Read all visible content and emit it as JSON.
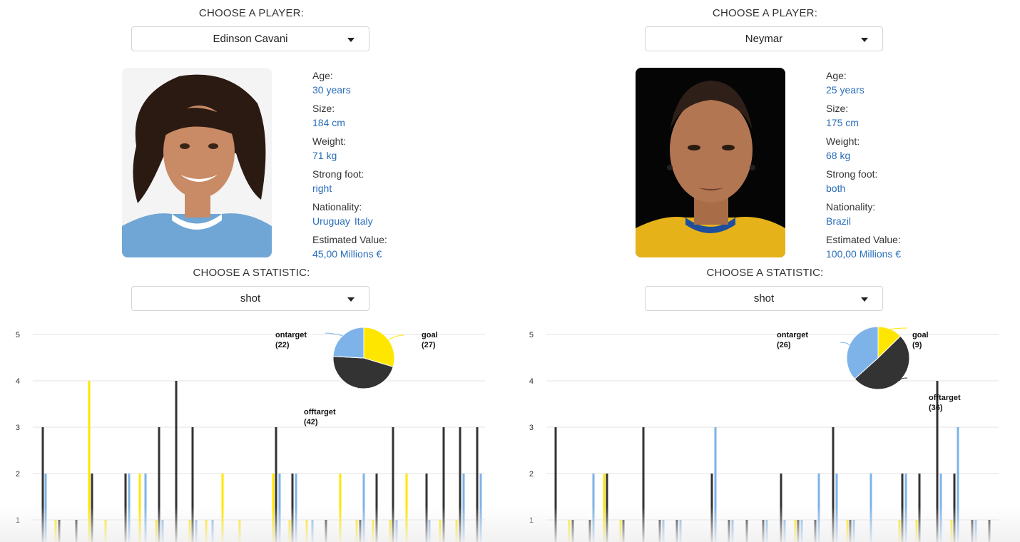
{
  "labels": {
    "choose_player": "CHOOSE A PLAYER:",
    "choose_statistic": "CHOOSE A STATISTIC:"
  },
  "colors": {
    "goal": "#ffe600",
    "ontarget": "#7db3e8",
    "offtarget": "#333333",
    "accent": "#2a6ebb"
  },
  "players": [
    {
      "name": "Edinson Cavani",
      "statistic": "shot",
      "stats": [
        {
          "key": "Age:",
          "value": "30 years"
        },
        {
          "key": "Size:",
          "value": "184 cm"
        },
        {
          "key": "Weight:",
          "value": "71 kg"
        },
        {
          "key": "Strong foot:",
          "value": "right"
        },
        {
          "key": "Nationality:",
          "value": "Uruguay",
          "value2": "Italy"
        },
        {
          "key": "Estimated Value:",
          "value": "45,00 Millions €"
        }
      ]
    },
    {
      "name": "Neymar",
      "statistic": "shot",
      "stats": [
        {
          "key": "Age:",
          "value": "25 years"
        },
        {
          "key": "Size:",
          "value": "175 cm"
        },
        {
          "key": "Weight:",
          "value": "68 kg"
        },
        {
          "key": "Strong foot:",
          "value": "both"
        },
        {
          "key": "Nationality:",
          "value": "Brazil"
        },
        {
          "key": "Estimated Value:",
          "value": "100,00 Millions €"
        }
      ]
    }
  ],
  "chart_data": [
    {
      "type": "bar",
      "ylim": [
        0,
        5
      ],
      "yticks": [
        1,
        2,
        3,
        4,
        5
      ],
      "grid": true,
      "series_order": [
        "offtarget",
        "ontarget",
        "goal"
      ],
      "bars": [
        {
          "x": 60,
          "s": "offtarget",
          "v": 3
        },
        {
          "x": 64,
          "s": "ontarget",
          "v": 2
        },
        {
          "x": 78,
          "s": "goal",
          "v": 1
        },
        {
          "x": 83,
          "s": "offtarget",
          "v": 1
        },
        {
          "x": 107,
          "s": "offtarget",
          "v": 1
        },
        {
          "x": 125,
          "s": "goal",
          "v": 4
        },
        {
          "x": 129,
          "s": "offtarget",
          "v": 2
        },
        {
          "x": 148,
          "s": "goal",
          "v": 1
        },
        {
          "x": 176,
          "s": "offtarget",
          "v": 2
        },
        {
          "x": 181,
          "s": "ontarget",
          "v": 2
        },
        {
          "x": 196,
          "s": "goal",
          "v": 2
        },
        {
          "x": 204,
          "s": "ontarget",
          "v": 2
        },
        {
          "x": 219,
          "s": "goal",
          "v": 1
        },
        {
          "x": 223,
          "s": "offtarget",
          "v": 3
        },
        {
          "x": 228,
          "s": "ontarget",
          "v": 1
        },
        {
          "x": 247,
          "s": "offtarget",
          "v": 4
        },
        {
          "x": 266,
          "s": "goal",
          "v": 1
        },
        {
          "x": 270,
          "s": "offtarget",
          "v": 3
        },
        {
          "x": 275,
          "s": "ontarget",
          "v": 1
        },
        {
          "x": 289,
          "s": "goal",
          "v": 1
        },
        {
          "x": 298,
          "s": "ontarget",
          "v": 1
        },
        {
          "x": 312,
          "s": "goal",
          "v": 2
        },
        {
          "x": 336,
          "s": "goal",
          "v": 1
        },
        {
          "x": 383,
          "s": "goal",
          "v": 2
        },
        {
          "x": 387,
          "s": "offtarget",
          "v": 3
        },
        {
          "x": 392,
          "s": "ontarget",
          "v": 2
        },
        {
          "x": 406,
          "s": "goal",
          "v": 1
        },
        {
          "x": 410,
          "s": "offtarget",
          "v": 2
        },
        {
          "x": 415,
          "s": "ontarget",
          "v": 2
        },
        {
          "x": 430,
          "s": "goal",
          "v": 1
        },
        {
          "x": 438,
          "s": "ontarget",
          "v": 1
        },
        {
          "x": 457,
          "s": "offtarget",
          "v": 1
        },
        {
          "x": 477,
          "s": "goal",
          "v": 2
        },
        {
          "x": 500,
          "s": "goal",
          "v": 1
        },
        {
          "x": 505,
          "s": "offtarget",
          "v": 1
        },
        {
          "x": 510,
          "s": "ontarget",
          "v": 2
        },
        {
          "x": 523,
          "s": "goal",
          "v": 1
        },
        {
          "x": 528,
          "s": "offtarget",
          "v": 2
        },
        {
          "x": 547,
          "s": "goal",
          "v": 1
        },
        {
          "x": 551,
          "s": "offtarget",
          "v": 3
        },
        {
          "x": 556,
          "s": "ontarget",
          "v": 1
        },
        {
          "x": 570,
          "s": "goal",
          "v": 2
        },
        {
          "x": 598,
          "s": "offtarget",
          "v": 2
        },
        {
          "x": 602,
          "s": "ontarget",
          "v": 1
        },
        {
          "x": 617,
          "s": "goal",
          "v": 1
        },
        {
          "x": 622,
          "s": "offtarget",
          "v": 3
        },
        {
          "x": 640,
          "s": "goal",
          "v": 1
        },
        {
          "x": 645,
          "s": "offtarget",
          "v": 3
        },
        {
          "x": 650,
          "s": "ontarget",
          "v": 2
        },
        {
          "x": 669,
          "s": "offtarget",
          "v": 3
        },
        {
          "x": 674,
          "s": "ontarget",
          "v": 2
        }
      ],
      "pie": {
        "slices": [
          {
            "name": "goal",
            "value": 27
          },
          {
            "name": "offtarget",
            "value": 42
          },
          {
            "name": "ontarget",
            "value": 22
          }
        ]
      }
    },
    {
      "type": "bar",
      "ylim": [
        0,
        5
      ],
      "yticks": [
        1,
        2,
        3,
        4,
        5
      ],
      "grid": true,
      "series_order": [
        "offtarget",
        "ontarget",
        "goal"
      ],
      "bars": [
        {
          "x": 59,
          "s": "offtarget",
          "v": 3
        },
        {
          "x": 78,
          "s": "goal",
          "v": 1
        },
        {
          "x": 83,
          "s": "offtarget",
          "v": 1
        },
        {
          "x": 107,
          "s": "offtarget",
          "v": 1
        },
        {
          "x": 112,
          "s": "ontarget",
          "v": 2
        },
        {
          "x": 127,
          "s": "goal",
          "v": 2
        },
        {
          "x": 131,
          "s": "offtarget",
          "v": 2
        },
        {
          "x": 150,
          "s": "goal",
          "v": 1
        },
        {
          "x": 154,
          "s": "offtarget",
          "v": 1
        },
        {
          "x": 182,
          "s": "offtarget",
          "v": 3
        },
        {
          "x": 205,
          "s": "offtarget",
          "v": 1
        },
        {
          "x": 210,
          "s": "ontarget",
          "v": 1
        },
        {
          "x": 229,
          "s": "offtarget",
          "v": 1
        },
        {
          "x": 234,
          "s": "ontarget",
          "v": 1
        },
        {
          "x": 278,
          "s": "offtarget",
          "v": 2
        },
        {
          "x": 283,
          "s": "ontarget",
          "v": 3
        },
        {
          "x": 302,
          "s": "offtarget",
          "v": 1
        },
        {
          "x": 307,
          "s": "ontarget",
          "v": 1
        },
        {
          "x": 327,
          "s": "offtarget",
          "v": 1
        },
        {
          "x": 350,
          "s": "offtarget",
          "v": 1
        },
        {
          "x": 355,
          "s": "ontarget",
          "v": 1
        },
        {
          "x": 375,
          "s": "offtarget",
          "v": 2
        },
        {
          "x": 380,
          "s": "ontarget",
          "v": 1
        },
        {
          "x": 395,
          "s": "goal",
          "v": 1
        },
        {
          "x": 399,
          "s": "offtarget",
          "v": 1
        },
        {
          "x": 404,
          "s": "ontarget",
          "v": 1
        },
        {
          "x": 423,
          "s": "offtarget",
          "v": 1
        },
        {
          "x": 428,
          "s": "ontarget",
          "v": 2
        },
        {
          "x": 448,
          "s": "offtarget",
          "v": 3
        },
        {
          "x": 453,
          "s": "ontarget",
          "v": 2
        },
        {
          "x": 468,
          "s": "goal",
          "v": 1
        },
        {
          "x": 472,
          "s": "offtarget",
          "v": 1
        },
        {
          "x": 477,
          "s": "ontarget",
          "v": 1
        },
        {
          "x": 501,
          "s": "ontarget",
          "v": 2
        },
        {
          "x": 541,
          "s": "goal",
          "v": 1
        },
        {
          "x": 545,
          "s": "offtarget",
          "v": 2
        },
        {
          "x": 550,
          "s": "ontarget",
          "v": 2
        },
        {
          "x": 565,
          "s": "goal",
          "v": 1
        },
        {
          "x": 569,
          "s": "offtarget",
          "v": 2
        },
        {
          "x": 594,
          "s": "offtarget",
          "v": 4
        },
        {
          "x": 599,
          "s": "ontarget",
          "v": 2
        },
        {
          "x": 614,
          "s": "goal",
          "v": 1
        },
        {
          "x": 618,
          "s": "offtarget",
          "v": 2
        },
        {
          "x": 623,
          "s": "ontarget",
          "v": 3
        },
        {
          "x": 643,
          "s": "offtarget",
          "v": 1
        },
        {
          "x": 648,
          "s": "ontarget",
          "v": 1
        },
        {
          "x": 667,
          "s": "offtarget",
          "v": 1
        }
      ],
      "pie": {
        "slices": [
          {
            "name": "goal",
            "value": 9
          },
          {
            "name": "offtarget",
            "value": 36
          },
          {
            "name": "ontarget",
            "value": 26
          }
        ]
      }
    }
  ]
}
